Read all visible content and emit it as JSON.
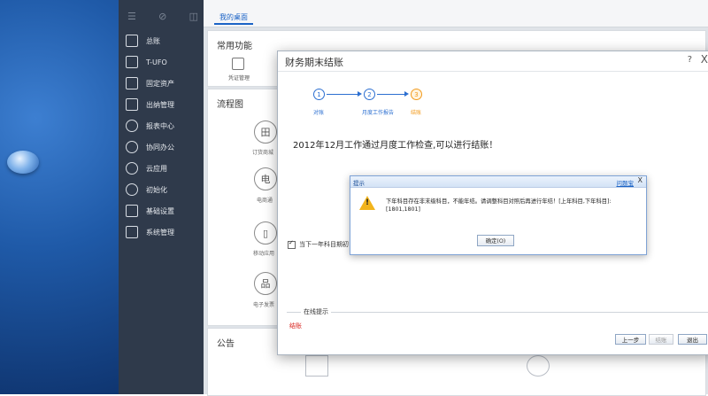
{
  "sidebar": {
    "items": [
      {
        "label": "总账",
        "icon": "ledger-icon"
      },
      {
        "label": "T-UFO",
        "icon": "ufo-report-icon"
      },
      {
        "label": "固定资产",
        "icon": "bank-building-icon"
      },
      {
        "label": "出纳管理",
        "icon": "cashier-icon"
      },
      {
        "label": "报表中心",
        "icon": "pie-chart-icon"
      },
      {
        "label": "协同办公",
        "icon": "collaboration-icon"
      },
      {
        "label": "云应用",
        "icon": "cloud-icon"
      },
      {
        "label": "初始化",
        "icon": "refresh-icon"
      },
      {
        "label": "基础设置",
        "icon": "settings-icon"
      },
      {
        "label": "系统管理",
        "icon": "system-code-icon"
      }
    ]
  },
  "workspace": {
    "home_tab": "我的桌面",
    "common_title": "常用功能",
    "voucher_label": "凭证管理",
    "flow_title": "流程图",
    "flow_nodes": [
      {
        "glyph": "田",
        "label": "订货商城"
      },
      {
        "glyph": "电",
        "label": "电商通"
      },
      {
        "glyph": "▯",
        "label": "移动应用"
      },
      {
        "glyph": "品",
        "label": "电子发票"
      }
    ],
    "notice_title": "公告"
  },
  "dialog": {
    "title": "财务期末结账",
    "help": "?",
    "close": "X",
    "steps": [
      {
        "num": "1",
        "label": "对账"
      },
      {
        "num": "2",
        "label": "月度工作报告"
      },
      {
        "num": "3",
        "label": "结账"
      }
    ],
    "main_message": "2012年12月工作通过月度工作检查,可以进行结账！",
    "checkbox_label": "当下一年科目期初",
    "online_legend": "在线提示",
    "online_text": "结账",
    "buttons": {
      "prev": "上一步",
      "close_account": "结账",
      "exit": "退出"
    }
  },
  "prompt": {
    "title": "提示",
    "link": "问题宝",
    "close": "X",
    "message": "下年科目存在非末级科目，不能年结。请调整科目对照后再进行年结！[上年科目,下年科目]:[1801,1801]",
    "ok_button": "确定(O)"
  },
  "colors": {
    "accent": "#1b63c6",
    "active_step": "#f29b1d",
    "error": "#d8241f",
    "sidebar": "#2f3a4b"
  }
}
